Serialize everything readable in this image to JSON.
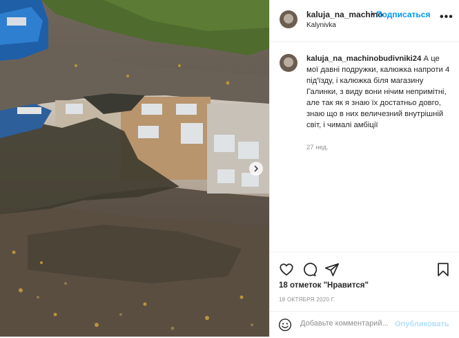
{
  "post": {
    "username": "kaluja_na_machino",
    "separator": "•",
    "follow_label": "Подписаться",
    "location": "Kalynivka",
    "more_label": "•••"
  },
  "caption": {
    "username": "kaluja_na_machinobudivniki24",
    "text": " А це мої давні подружки, калюжка напроти 4 під'їзду, і калюжка біля магазину Галинки, з виду вони нічим непримітні, але так як я знаю їх достатньо довго, знаю що в них величезний внутрішній світ, і чималі амбіції",
    "time_ago": "27 нед."
  },
  "actions": {
    "likes": "18 отметок \"Нравится\"",
    "date": "18 ОКТЯБРЯ 2020 Г."
  },
  "comment": {
    "placeholder": "Добавьте комментарий...",
    "publish_label": "Опубликовать"
  },
  "icons": [
    "heart-icon",
    "comment-icon",
    "share-icon",
    "bookmark-icon",
    "emoji-icon",
    "chevron-right-icon",
    "more-icon"
  ],
  "colors": {
    "link": "#0095f6",
    "publish_disabled": "#b2dffc",
    "muted": "#8e8e8e",
    "text": "#262626"
  }
}
